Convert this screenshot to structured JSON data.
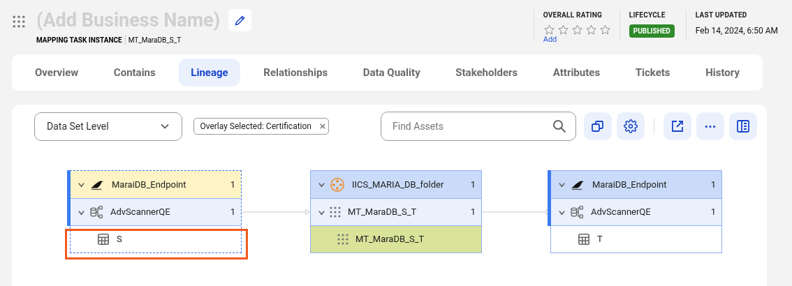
{
  "header": {
    "title": "(Add Business Name)",
    "type_label": "MAPPING TASK INSTANCE",
    "name": "MT_MaraDB_S_T",
    "rating": {
      "label": "OVERALL RATING",
      "stars": 0,
      "action": "Add"
    },
    "lifecycle": {
      "label": "LIFECYCLE",
      "status": "PUBLISHED"
    },
    "updated": {
      "label": "LAST UPDATED",
      "value": "Feb 14, 2024, 6:50 AM"
    }
  },
  "tabs": [
    {
      "label": "Overview",
      "selected": false
    },
    {
      "label": "Contains",
      "selected": false
    },
    {
      "label": "Lineage",
      "selected": true
    },
    {
      "label": "Relationships",
      "selected": false
    },
    {
      "label": "Data Quality",
      "selected": false
    },
    {
      "label": "Stakeholders",
      "selected": false
    },
    {
      "label": "Attributes",
      "selected": false
    },
    {
      "label": "Tickets",
      "selected": false
    },
    {
      "label": "History",
      "selected": false
    }
  ],
  "toolbar": {
    "level": "Data Set Level",
    "overlay": "Overlay Selected: Certification",
    "search": {
      "placeholder": "Find Assets"
    }
  },
  "nodes": [
    {
      "selected": true,
      "accent": true,
      "rows": [
        {
          "kind": "endpoint",
          "label": "MaraiDB_Endpoint",
          "count": "1",
          "expanded": true,
          "color": "#fdf3c4",
          "highlighted": false
        },
        {
          "kind": "scanner",
          "label": "AdvScannerQE",
          "count": "1",
          "expanded": true,
          "color": "#eaf1fd",
          "highlighted": false
        },
        {
          "kind": "table",
          "label": "S",
          "color": "#ffffff",
          "highlighted": true
        }
      ]
    },
    {
      "selected": false,
      "accent": false,
      "rows": [
        {
          "kind": "folder",
          "label": "IICS_MARIA_DB_folder",
          "count": "1",
          "expanded": true,
          "color": "#c9dbf8",
          "highlighted": false
        },
        {
          "kind": "task",
          "label": "MT_MaraDB_S_T",
          "count": "1",
          "expanded": true,
          "color": "#eaf1fd",
          "highlighted": false
        },
        {
          "kind": "task",
          "label": "MT_MaraDB_S_T",
          "color": "#d9e39a",
          "highlighted": false
        }
      ]
    },
    {
      "selected": false,
      "accent": true,
      "rows": [
        {
          "kind": "endpoint",
          "label": "MaraiDB_Endpoint",
          "count": "1",
          "expanded": true,
          "color": "#c9dbf8",
          "highlighted": false
        },
        {
          "kind": "scanner",
          "label": "AdvScannerQE",
          "count": "1",
          "expanded": true,
          "color": "#eaf1fd",
          "highlighted": false
        },
        {
          "kind": "table",
          "label": "T",
          "color": "#ffffff",
          "highlighted": false
        }
      ]
    }
  ]
}
